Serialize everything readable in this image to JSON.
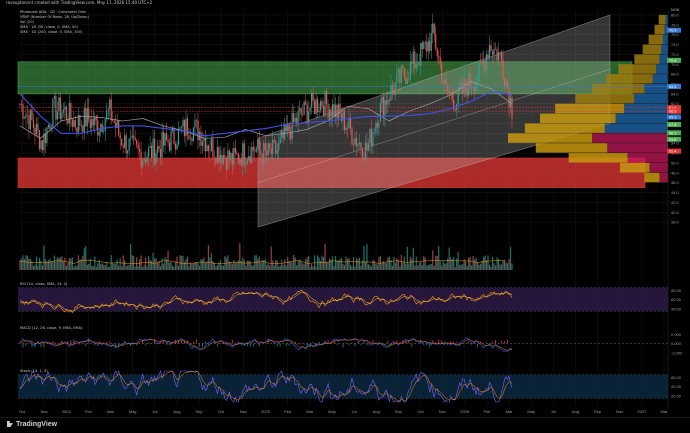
{
  "header_text": "raveuptonnnt created with TradingView.com, May 11, 2026 15:40 UTC+2",
  "legend": [
    {
      "text": "Photocast ADA · 1D · Coinmetal Odis",
      "color": "#c8c8c8"
    },
    {
      "text": "VRVP (Number Of Rows, 28, Up/Down)",
      "color": "#c8c8c8"
    },
    {
      "text": "Vol (20)",
      "color": "#c8c8c8"
    },
    {
      "text": "SMA · 1D (50, close, 0, SMA, 50)",
      "color": "#c8c8c8"
    },
    {
      "text": "SMA · 1D (200, close, 0, SMA, 200)",
      "color": "#c8c8c8"
    }
  ],
  "price_axis": {
    "unit_label": "NOK",
    "ticks": [
      "80.0",
      "78.0",
      "76.0",
      "74.0",
      "72.0",
      "70.0",
      "68.0",
      "66.0",
      "64.0",
      "62.0",
      "60.0",
      "58.0",
      "56.0",
      "54.0",
      "52.0",
      "50.0",
      "48.0",
      "46.0",
      "44.0",
      "42.0",
      "40.0",
      "38.0"
    ],
    "markers": [
      {
        "label": "76.9",
        "color": "#3a7bd5"
      },
      {
        "label": "70.8",
        "color": "#4caf50"
      },
      {
        "label": "65.5",
        "color": "#3a7bd5"
      },
      {
        "label": "61.2",
        "color": "#e53935"
      },
      {
        "label": "60.5",
        "color": "#e53935"
      },
      {
        "label": "59.3",
        "color": "#3a7bd5"
      },
      {
        "label": "57.8",
        "color": "#4caf50"
      },
      {
        "label": "56.1",
        "color": "#4caf50"
      },
      {
        "label": "54.8",
        "color": "#4caf50"
      },
      {
        "label": "52.4",
        "color": "#e53935"
      }
    ]
  },
  "time_axis": [
    "Oct",
    "Nov",
    "2024",
    "Feb",
    "Mar",
    "May",
    "Jul",
    "Aug",
    "Sep",
    "Oct",
    "Nov",
    "2025",
    "Feb",
    "Mar",
    "May",
    "Jul",
    "Aug",
    "Sep",
    "Oct",
    "Nov",
    "2026",
    "Feb",
    "Mar",
    "May",
    "Jul",
    "Aug",
    "Sep",
    "Nov",
    "2027",
    "Mar"
  ],
  "panes": {
    "rsi": {
      "title": "RSI (14, close, SMA, 14, 2)",
      "ticks": [
        "80.00",
        "60.00",
        "40.00"
      ]
    },
    "macd": {
      "title": "MACD (12, 26, close, 9, EMA, EMA)",
      "ticks": [
        "2.000",
        "0.000",
        "-2.000"
      ]
    },
    "stoch": {
      "title": "Stoch (14, 1, 3)",
      "ticks": [
        "80.00",
        "40.00",
        "20.00"
      ]
    }
  },
  "footer": {
    "brand": "TradingView"
  },
  "colors": {
    "up": "#26a69a",
    "down": "#ef5350",
    "sma50": "#9e9e9e",
    "sma200": "#3f51e8",
    "green_zone": "#4caf50",
    "red_zone": "#e53935",
    "channel": "#bdbdbd",
    "rsi": "#ff9800",
    "rsi_band": "#311b4a",
    "macd": "#2962ff",
    "signal": "#ff6d00",
    "stoch_k": "#7b61ff",
    "stoch_d": "#ff9800"
  },
  "chart_data": {
    "type": "candlestick",
    "ylim": [
      36,
      81
    ],
    "x_range_months": [
      "2023-10",
      "2027-03"
    ],
    "sma50": [
      57.5,
      55.0,
      58.5,
      59.5,
      59.2,
      58.5,
      59.0,
      57.5,
      56.5,
      55.0,
      55.2,
      56.8,
      55.5,
      56.0,
      56.8,
      58.5,
      61.5,
      61.0,
      58.5,
      60.5,
      62.0,
      63.8,
      66.5,
      65.0,
      62.0
    ],
    "sma200": [
      64.0,
      59.5,
      56.0,
      56.0,
      57.0,
      57.5,
      57.5,
      57.0,
      56.5,
      55.5,
      56.0,
      56.5,
      57.0,
      57.8,
      58.2,
      58.5,
      59.0,
      59.4,
      59.5,
      59.6,
      60.0,
      61.0,
      62.5,
      64.5,
      63.8
    ],
    "close": [
      62.0,
      58.5,
      54.0,
      61.0,
      60.5,
      58.0,
      59.0,
      57.5,
      60.5,
      55.0,
      53.0,
      51.5,
      52.5,
      54.0,
      55.5,
      57.5,
      56.5,
      53.5,
      52.0,
      50.5,
      52.0,
      53.0,
      51.5,
      52.5,
      56.5,
      59.5,
      61.5,
      62.5,
      61.0,
      58.5,
      55.0,
      52.5,
      60.0,
      64.0,
      67.0,
      69.5,
      72.5,
      76.0,
      65.0,
      62.5,
      66.0,
      67.5,
      74.0,
      71.5,
      61.2
    ],
    "volume_profile": [
      {
        "price": 79.0,
        "up": 8,
        "down": 3
      },
      {
        "price": 77.0,
        "up": 12,
        "down": 4
      },
      {
        "price": 75.0,
        "up": 17,
        "down": 6
      },
      {
        "price": 73.0,
        "up": 22,
        "down": 8
      },
      {
        "price": 71.0,
        "up": 30,
        "down": 10
      },
      {
        "price": 69.0,
        "up": 45,
        "down": 14
      },
      {
        "price": 67.0,
        "up": 55,
        "down": 18
      },
      {
        "price": 65.0,
        "up": 62,
        "down": 28
      },
      {
        "price": 63.0,
        "up": 70,
        "down": 40
      },
      {
        "price": 61.0,
        "up": 82,
        "down": 52
      },
      {
        "price": 59.0,
        "up": 90,
        "down": 62
      },
      {
        "price": 57.0,
        "up": 95,
        "down": 75
      },
      {
        "price": 55.0,
        "up": 100,
        "down": 90
      },
      {
        "price": 53.0,
        "up": 85,
        "down": 72
      },
      {
        "price": 51.0,
        "up": 70,
        "down": 48
      },
      {
        "price": 49.0,
        "up": 35,
        "down": 22
      },
      {
        "price": 47.0,
        "up": 18,
        "down": 10
      }
    ],
    "zones": [
      {
        "name": "green",
        "from": 64.0,
        "to": 70.5,
        "color": "#4caf50"
      },
      {
        "name": "red",
        "from": 45.0,
        "to": 51.0,
        "color": "#e53935"
      }
    ]
  }
}
